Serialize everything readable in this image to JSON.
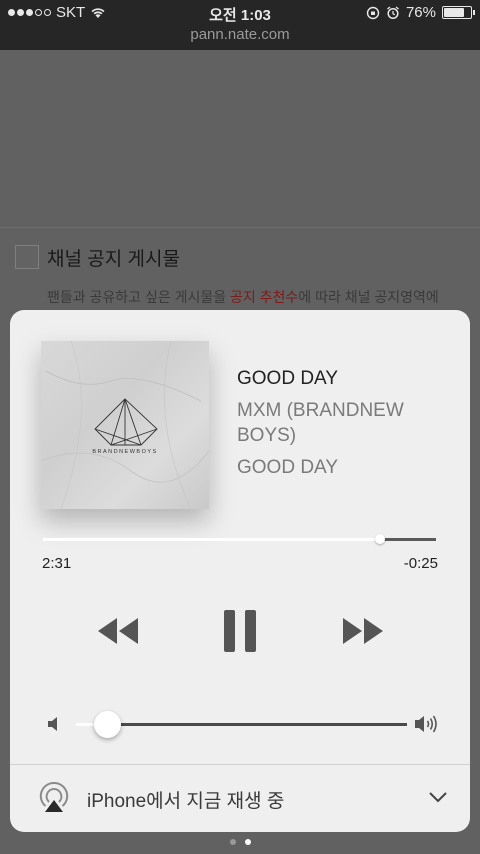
{
  "status_bar": {
    "carrier": "SKT",
    "time": "오전 1:03",
    "battery": "76%",
    "battery_level": 0.76
  },
  "browser": {
    "url": "pann.nate.com"
  },
  "background": {
    "checkbox_label": "채널 공지 게시물",
    "desc_before": "팬들과 공유하고 싶은 게시물을 ",
    "desc_highlight": "공지 추천수",
    "desc_after": "에 따라 채널 공지영역에"
  },
  "player": {
    "title": "GOOD DAY",
    "artist": "MXM (BRANDNEW BOYS)",
    "album": "GOOD DAY",
    "artwork_text": "BRANDNEWBOYS",
    "elapsed": "2:31",
    "remaining": "-0:25",
    "progress": 0.858,
    "volume": 0.095
  },
  "airplay": {
    "label": "iPhone에서 지금 재생 중"
  },
  "page_indicator": {
    "count": 2,
    "active": 1
  },
  "colors": {
    "panel_bg": "#efefef",
    "highlight": "#7a1c1c",
    "control": "#555555"
  }
}
